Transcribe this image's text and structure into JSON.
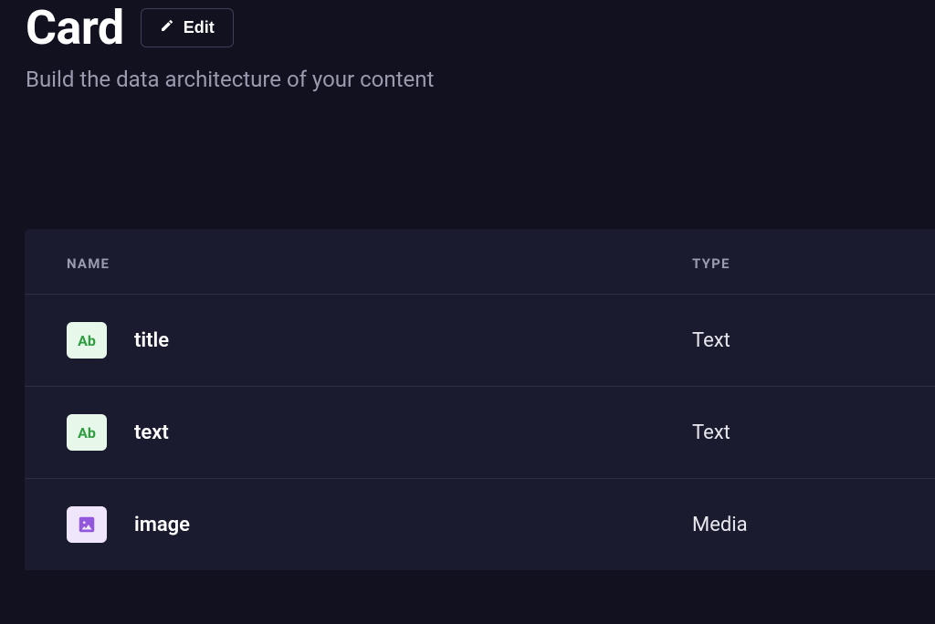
{
  "header": {
    "title": "Card",
    "edit_label": "Edit",
    "subtitle": "Build the data architecture of your content"
  },
  "table": {
    "columns": {
      "name": "NAME",
      "type": "TYPE"
    },
    "rows": [
      {
        "badge_kind": "text",
        "badge_label": "Ab",
        "name": "title",
        "type": "Text"
      },
      {
        "badge_kind": "text",
        "badge_label": "Ab",
        "name": "text",
        "type": "Text"
      },
      {
        "badge_kind": "media",
        "badge_label": "",
        "name": "image",
        "type": "Media"
      }
    ]
  }
}
